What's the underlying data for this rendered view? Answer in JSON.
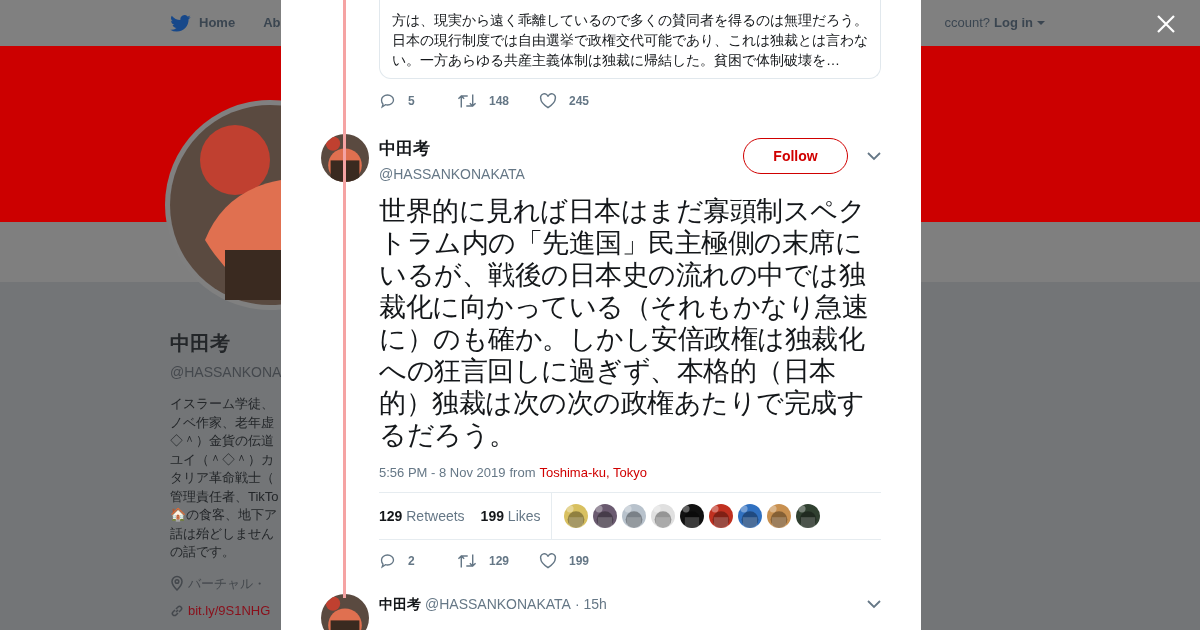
{
  "header": {
    "nav": [
      "Home",
      "Ab"
    ],
    "account_prompt": "ccount?",
    "login": "Log in"
  },
  "profile": {
    "name": "中田考",
    "handle": "@HASSANKONA",
    "bio": [
      "イスラーム学徒、",
      "ノベ作家、老年虚",
      "◇＾）金貨の伝道",
      "ユイ（＾◇＾）カ",
      "タリア革命戦士（",
      "管理責任者、TikTo",
      "🏠の食客、地下ア",
      "話は殆どしません",
      "の話です。"
    ],
    "location": "バーチャル・",
    "link": "bit.ly/9S1NHG"
  },
  "quoted_text": "方は、現実から遠く乖離しているので多くの賛同者を得るのは無理だろう。日本の現行制度では自由選挙で政権交代可能であり、これは独裁とは言わない。一方あらゆる共産主義体制は独裁に帰結した。貧困で体制破壊を…",
  "prev_actions": {
    "replies": "5",
    "retweets": "148",
    "likes": "245"
  },
  "tweet": {
    "name": "中田考",
    "handle": "@HASSANKONAKATA",
    "follow": "Follow",
    "text": "世界的に見れば日本はまだ寡頭制スペクトラム内の「先進国」民主極側の末席にいるが、戦後の日本史の流れの中では独裁化に向かっている（それもかなり急速に）のも確か。しかし安倍政権は独裁化への狂言回しに過ぎず、本格的（日本的）独裁は次の次の政権あたりで完成するだろう。",
    "time": "5:56 PM - 8 Nov 2019",
    "from": "from",
    "place": "Toshima-ku, Tokyo",
    "retweet_count": "129",
    "retweet_label": "Retweets",
    "like_count": "199",
    "like_label": "Likes",
    "likers": [
      {
        "color": "#d8c060"
      },
      {
        "color": "#6a5a70"
      },
      {
        "color": "#b8c2cc"
      },
      {
        "color": "#e0e0e0"
      },
      {
        "color": "#111111"
      },
      {
        "color": "#c03020"
      },
      {
        "color": "#3070c0"
      },
      {
        "color": "#c89050"
      },
      {
        "color": "#304030"
      }
    ],
    "actions": {
      "replies": "2",
      "retweets": "129",
      "likes": "199"
    }
  },
  "reply": {
    "name": "中田考",
    "handle": "@HASSANKONAKATA",
    "age": "· 15h"
  }
}
